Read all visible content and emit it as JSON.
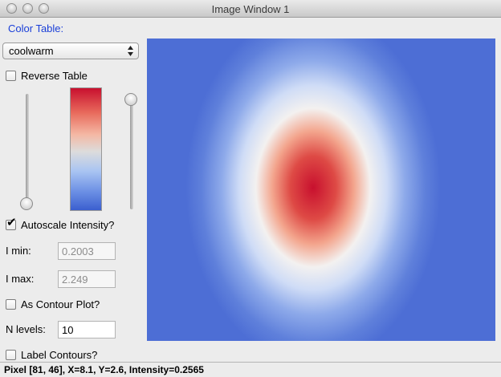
{
  "window": {
    "title": "Image Window 1"
  },
  "sidebar": {
    "color_table_label": "Color Table:",
    "color_table_value": "coolwarm",
    "reverse_table": {
      "label": "Reverse Table",
      "checked": false
    },
    "autoscale": {
      "label": "Autoscale Intensity?",
      "checked": true
    },
    "imin": {
      "label": "I min:",
      "value": "0.2003"
    },
    "imax": {
      "label": "I max:",
      "value": "2.249"
    },
    "contour": {
      "label": "As Contour Plot?",
      "checked": false
    },
    "nlevels": {
      "label": "N levels:",
      "value": "10"
    },
    "label_contours": {
      "label": "Label Contours?",
      "checked": false
    },
    "slider_low_value": 0.0,
    "slider_high_value": 1.0
  },
  "colormap": {
    "top": "#c8102e",
    "mid": "#dcdcdc",
    "bottom": "#3b5fcf"
  },
  "status": {
    "text": "Pixel [81, 46], X=8.1, Y=2.6, Intensity=0.2565"
  }
}
